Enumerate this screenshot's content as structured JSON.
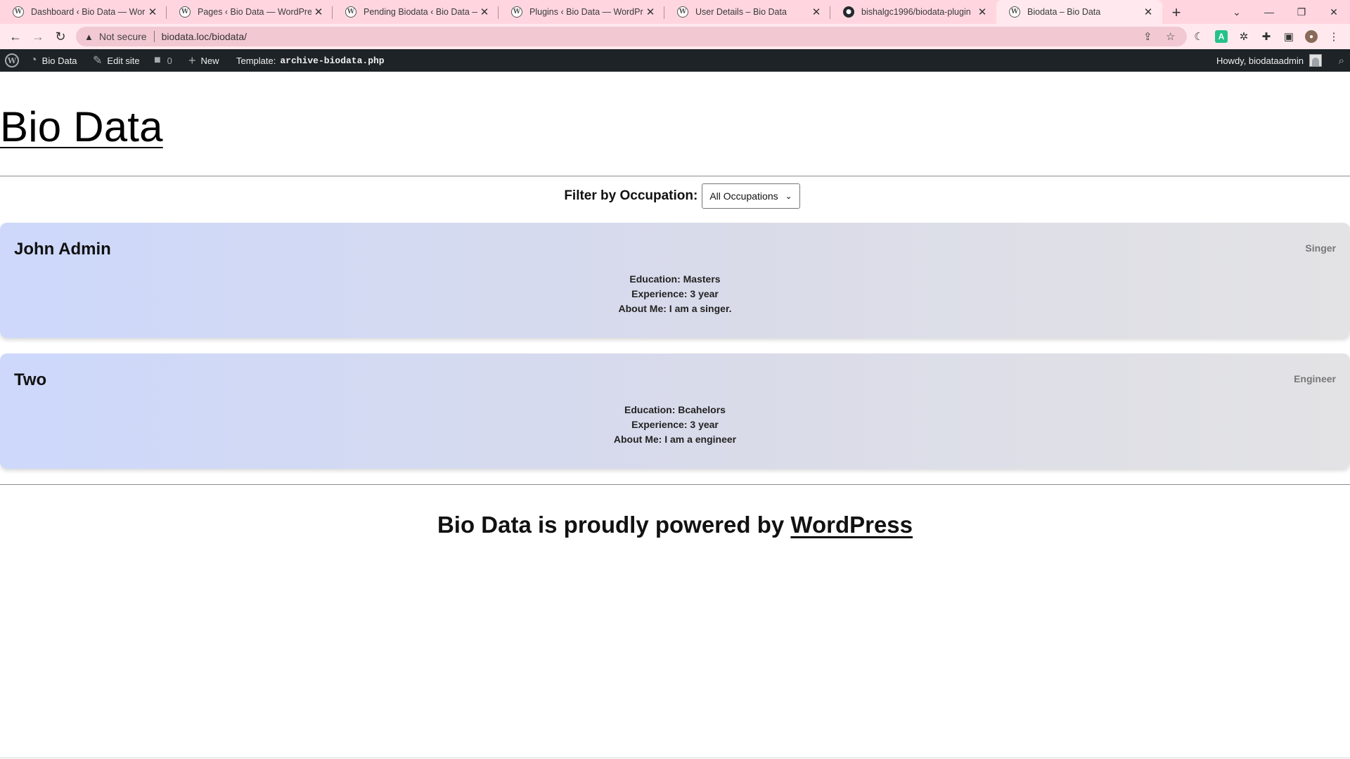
{
  "browser": {
    "tabs": [
      {
        "title": "Dashboard ‹ Bio Data — WordPress",
        "icon": "wordpress-icon"
      },
      {
        "title": "Pages ‹ Bio Data — WordPress",
        "icon": "wordpress-icon"
      },
      {
        "title": "Pending Biodata ‹ Bio Data — WordPress",
        "icon": "wordpress-icon"
      },
      {
        "title": "Plugins ‹ Bio Data — WordPress",
        "icon": "wordpress-icon"
      },
      {
        "title": "User Details – Bio Data",
        "icon": "wordpress-icon"
      },
      {
        "title": "bishalgc1996/biodata-plugin",
        "icon": "github-icon"
      },
      {
        "title": "Biodata – Bio Data",
        "icon": "wordpress-icon",
        "active": true
      }
    ],
    "security_label": "Not secure",
    "url": "biodata.loc/biodata/"
  },
  "adminbar": {
    "site_name": "Bio Data",
    "edit_site": "Edit site",
    "comments_count": "0",
    "new_label": "New",
    "template_label": "Template:",
    "template_file": "archive-biodata.php",
    "howdy": "Howdy, biodataadmin"
  },
  "page": {
    "site_title": "Bio Data",
    "filter": {
      "label": "Filter by Occupation:",
      "selected": "All Occupations"
    },
    "cards": [
      {
        "name": "John Admin",
        "occupation": "Singer",
        "education": "Education: Masters",
        "experience": "Experience: 3 year",
        "about": "About Me: I am a singer."
      },
      {
        "name": "Two",
        "occupation": "Engineer",
        "education": "Education: Bcahelors",
        "experience": "Experience: 3 year",
        "about": "About Me: I am a engineer"
      }
    ],
    "footer": {
      "text": "Bio Data is proudly powered by",
      "link": "WordPress"
    }
  },
  "colors": {
    "tabstrip": "#ffd6df",
    "adminbar": "#1d2327",
    "card_gradient_start": "#cdd8fb",
    "card_gradient_end": "#e3e3e5"
  }
}
